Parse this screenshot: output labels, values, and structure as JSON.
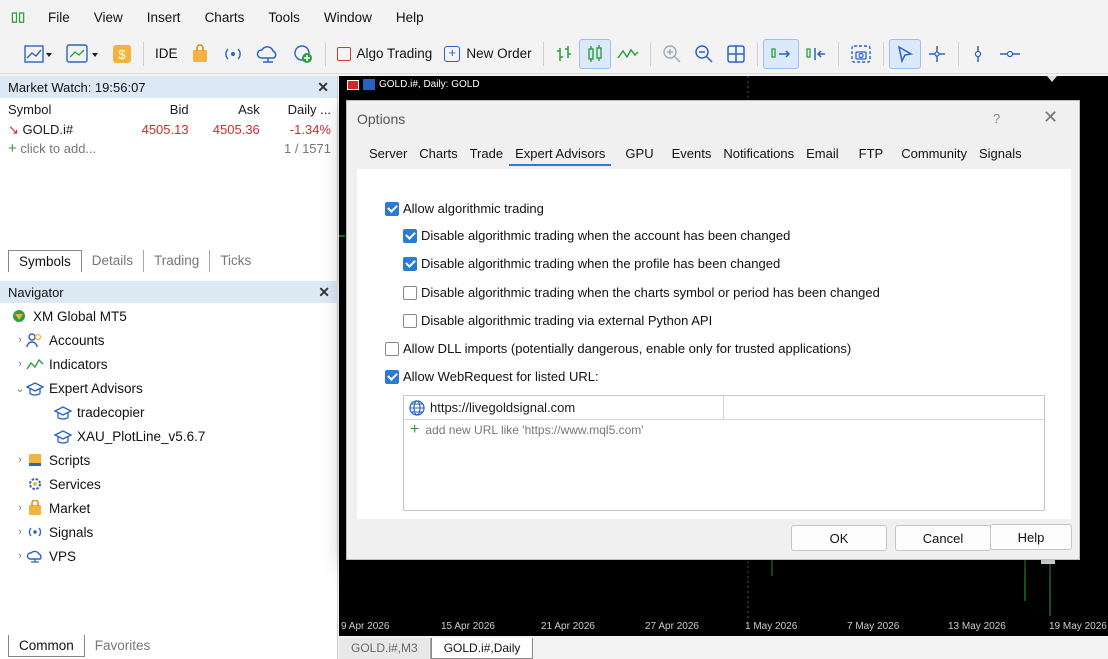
{
  "menu": [
    "File",
    "View",
    "Insert",
    "Charts",
    "Tools",
    "Window",
    "Help"
  ],
  "toolbar": {
    "ide": "IDE",
    "algo_trading": "Algo Trading",
    "new_order": "New Order"
  },
  "market_watch": {
    "title": "Market Watch: 19:56:07",
    "columns": [
      "Symbol",
      "Bid",
      "Ask",
      "Daily ..."
    ],
    "rows": [
      {
        "symbol": "GOLD.i#",
        "bid": "4505.13",
        "ask": "4505.36",
        "daily": "-1.34%"
      }
    ],
    "add_label": "click to add...",
    "count": "1 / 1571",
    "tabs": [
      "Symbols",
      "Details",
      "Trading",
      "Ticks"
    ]
  },
  "navigator": {
    "title": "Navigator",
    "items": [
      {
        "label": "XM Global MT5",
        "level": 0,
        "chev": ""
      },
      {
        "label": "Accounts",
        "level": 1,
        "chev": "›"
      },
      {
        "label": "Indicators",
        "level": 1,
        "chev": "›"
      },
      {
        "label": "Expert Advisors",
        "level": 1,
        "chev": "⌄"
      },
      {
        "label": "tradecopier",
        "level": 2,
        "chev": ""
      },
      {
        "label": "XAU_PlotLine_v5.6.7",
        "level": 2,
        "chev": ""
      },
      {
        "label": "Scripts",
        "level": 1,
        "chev": "›"
      },
      {
        "label": "Services",
        "level": 1,
        "chev": ""
      },
      {
        "label": "Market",
        "level": 1,
        "chev": "›"
      },
      {
        "label": "Signals",
        "level": 1,
        "chev": "›"
      },
      {
        "label": "VPS",
        "level": 1,
        "chev": "›"
      }
    ],
    "bottom_tabs": [
      "Common",
      "Favorites"
    ]
  },
  "chart": {
    "title": "GOLD.i#, Daily:  GOLD",
    "dates": [
      "9 Apr 2026",
      "15 Apr 2026",
      "21 Apr 2026",
      "27 Apr 2026",
      "1 May 2026",
      "7 May 2026",
      "13 May 2026",
      "19 May 2026"
    ],
    "tabs": [
      "GOLD.i#,M3",
      "GOLD.i#,Daily"
    ]
  },
  "dialog": {
    "title": "Options",
    "help_mark": "?",
    "close_mark": "✕",
    "tabs": [
      "Server",
      "Charts",
      "Trade",
      "Expert Advisors",
      "GPU",
      "Events",
      "Notifications",
      "Email",
      "FTP",
      "Community",
      "Signals"
    ],
    "options": [
      {
        "label": "Allow algorithmic trading",
        "checked": true
      },
      {
        "label": "Disable algorithmic trading when the account has been changed",
        "checked": true
      },
      {
        "label": "Disable algorithmic trading when the profile has been changed",
        "checked": true
      },
      {
        "label": "Disable algorithmic trading when the charts symbol or period has been changed",
        "checked": false
      },
      {
        "label": "Disable algorithmic trading via external Python API",
        "checked": false
      },
      {
        "label": "Allow DLL imports (potentially dangerous, enable only for trusted applications)",
        "checked": false
      },
      {
        "label": "Allow WebRequest for listed URL:",
        "checked": true
      }
    ],
    "url": "https://livegoldsignal.com",
    "add_url": "add new URL like 'https://www.mql5.com'",
    "buttons": {
      "ok": "OK",
      "cancel": "Cancel",
      "help": "Help"
    }
  }
}
